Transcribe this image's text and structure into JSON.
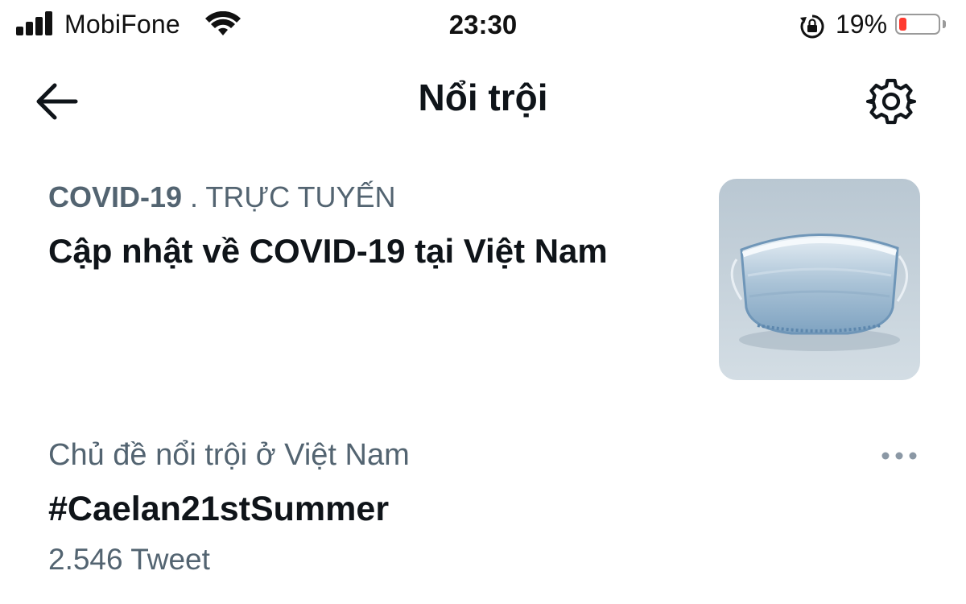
{
  "status_bar": {
    "carrier": "MobiFone",
    "time": "23:30",
    "battery_percent": "19%",
    "battery_level": 0.19,
    "battery_color": "#ff3b30",
    "icons": [
      "signal-bars-icon",
      "wifi-icon",
      "orientation-lock-icon",
      "battery-icon"
    ]
  },
  "header": {
    "title": "Nổi trội",
    "back_icon": "arrow-left-icon",
    "settings_icon": "gear-icon"
  },
  "trends": [
    {
      "category": "COVID-19",
      "separator": " . ",
      "status": "TRỰC TUYẾN",
      "title": "Cập nhật về COVID-19 tại Việt Nam",
      "thumbnail": "face-mask-image"
    },
    {
      "context": "Chủ đề nổi trội ở Việt Nam",
      "name": "#Caelan21stSummer",
      "count": "2.546 Tweet",
      "more_icon": "more-dots-icon"
    }
  ],
  "colors": {
    "text_primary": "#0f1419",
    "text_secondary": "#536471",
    "background": "#ffffff"
  }
}
